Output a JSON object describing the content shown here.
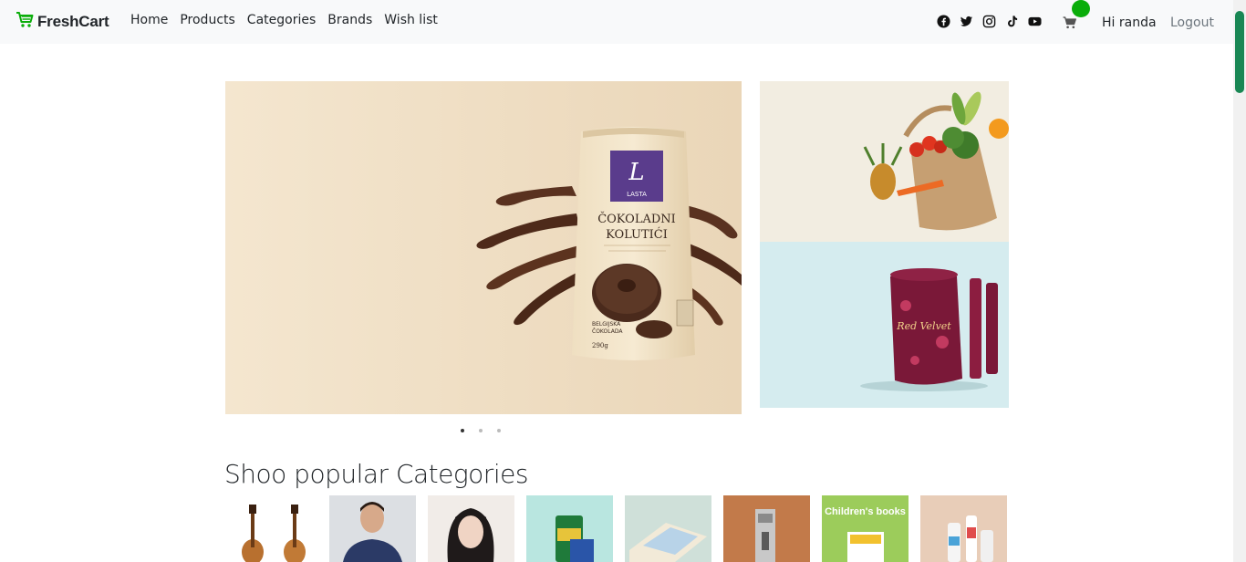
{
  "navbar": {
    "brand": "FreshCart",
    "links": [
      "Home",
      "Products",
      "Categories",
      "Brands",
      "Wish list"
    ],
    "social_icons": [
      "facebook-icon",
      "twitter-icon",
      "instagram-icon",
      "tiktok-icon",
      "youtube-icon"
    ],
    "greeting": "Hi randa",
    "logout": "Logout"
  },
  "slider": {
    "main_product_brand": "LASTA",
    "main_product_name": "ČOKOLADNI KOLUTIĆI",
    "main_product_sub": "BELGIJSKA ČOKOLADA",
    "main_product_weight": "290g",
    "side_bottom_product": "Red Velvet",
    "dots": 3,
    "active_dot": 0
  },
  "categories": {
    "title": "Shoo popular Categories",
    "items": [
      {
        "name": "music",
        "overlay": ""
      },
      {
        "name": "men-fashion",
        "overlay": ""
      },
      {
        "name": "women-fashion",
        "overlay": ""
      },
      {
        "name": "supermarket",
        "overlay": ""
      },
      {
        "name": "baby-toys",
        "overlay": ""
      },
      {
        "name": "home",
        "overlay": ""
      },
      {
        "name": "books",
        "overlay": "Children's books"
      },
      {
        "name": "beauty-health",
        "overlay": ""
      }
    ]
  },
  "colors": {
    "brand_green": "#0aad0a",
    "navbar_bg": "#f8f9fa",
    "scroll_thumb": "#198754"
  }
}
